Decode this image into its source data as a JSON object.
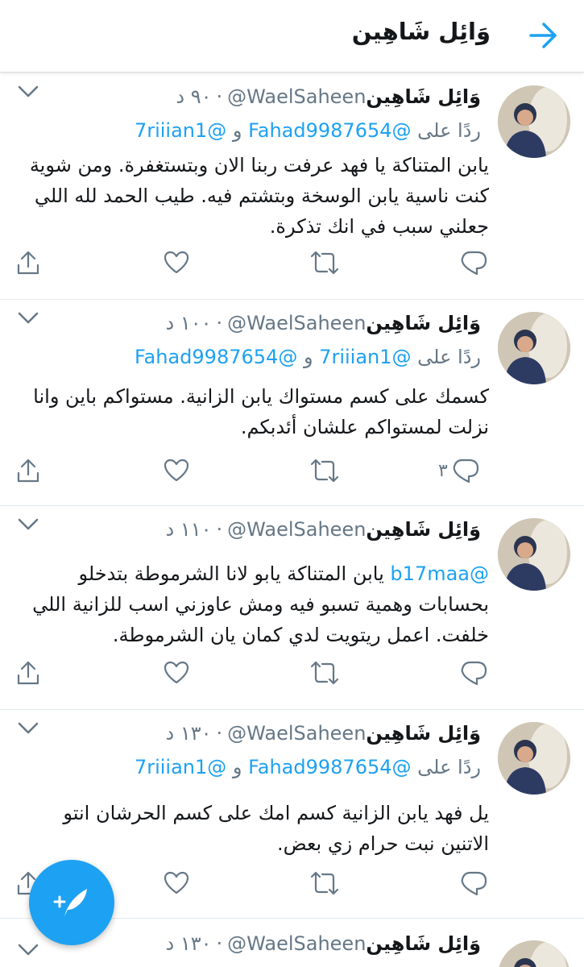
{
  "header": {
    "title": "وَائِل شَاهِين",
    "back_icon": "arrow-right-icon"
  },
  "tweets": [
    {
      "name": "وَائِل شَاهِين",
      "handle": "@WaelSaheen",
      "time": "٩٠ د",
      "reply_prefix": "ردًا على",
      "mention_a": "@Fahad9987654",
      "conj": "و",
      "mention_b": "@7riiian1",
      "text": "يابن المتناكة يا فهد عرفت ربنا الان وبتستغفرة. ومن شوية كنت ناسية يابن الوسخة وبتشتم فيه. طيب الحمد لله اللي جعلني سبب في انك تذكرة.",
      "reply_count": ""
    },
    {
      "name": "وَائِل شَاهِين",
      "handle": "@WaelSaheen",
      "time": "١٠٠ د",
      "reply_prefix": "ردًا على",
      "mention_a": "@7riiian1",
      "conj": "و",
      "mention_b": "@Fahad9987654",
      "text": "كسمك على كسم مستواك يابن الزانية. مستواكم باين وانا نزلت لمستواكم علشان أئدبكم.",
      "reply_count": "٣"
    },
    {
      "name": "وَائِل شَاهِين",
      "handle": "@WaelSaheen",
      "time": "١١٠ د",
      "inline_mention": "@b17maa",
      "text": "يابن المتناكة يابو لانا الشرموطة بتدخلو بحسابات وهمية تسبو فيه ومش عاوزني اسب للزانية اللي خلفت. اعمل ريتويت لدي كمان يان الشرموطة.",
      "reply_count": ""
    },
    {
      "name": "وَائِل شَاهِين",
      "handle": "@WaelSaheen",
      "time": "١٣٠ د",
      "reply_prefix": "ردًا على",
      "mention_a": "@Fahad9987654",
      "conj": "و",
      "mention_b": "@7riiian1",
      "text": "يل فهد يابن الزانية كسم امك على كسم الحرشان انتو الاتنين نبت حرام زي بعض.",
      "reply_count": ""
    },
    {
      "name": "وَائِل شَاهِين",
      "handle": "@WaelSaheen",
      "time": "١٣٠ د"
    }
  ],
  "colors": {
    "accent": "#1da1f2",
    "muted": "#657786",
    "text": "#14171a",
    "divider": "#e1e8ed"
  },
  "icons": [
    "chevron-down-icon",
    "share-icon",
    "like-icon",
    "retweet-icon",
    "reply-icon",
    "compose-tweet-icon"
  ]
}
